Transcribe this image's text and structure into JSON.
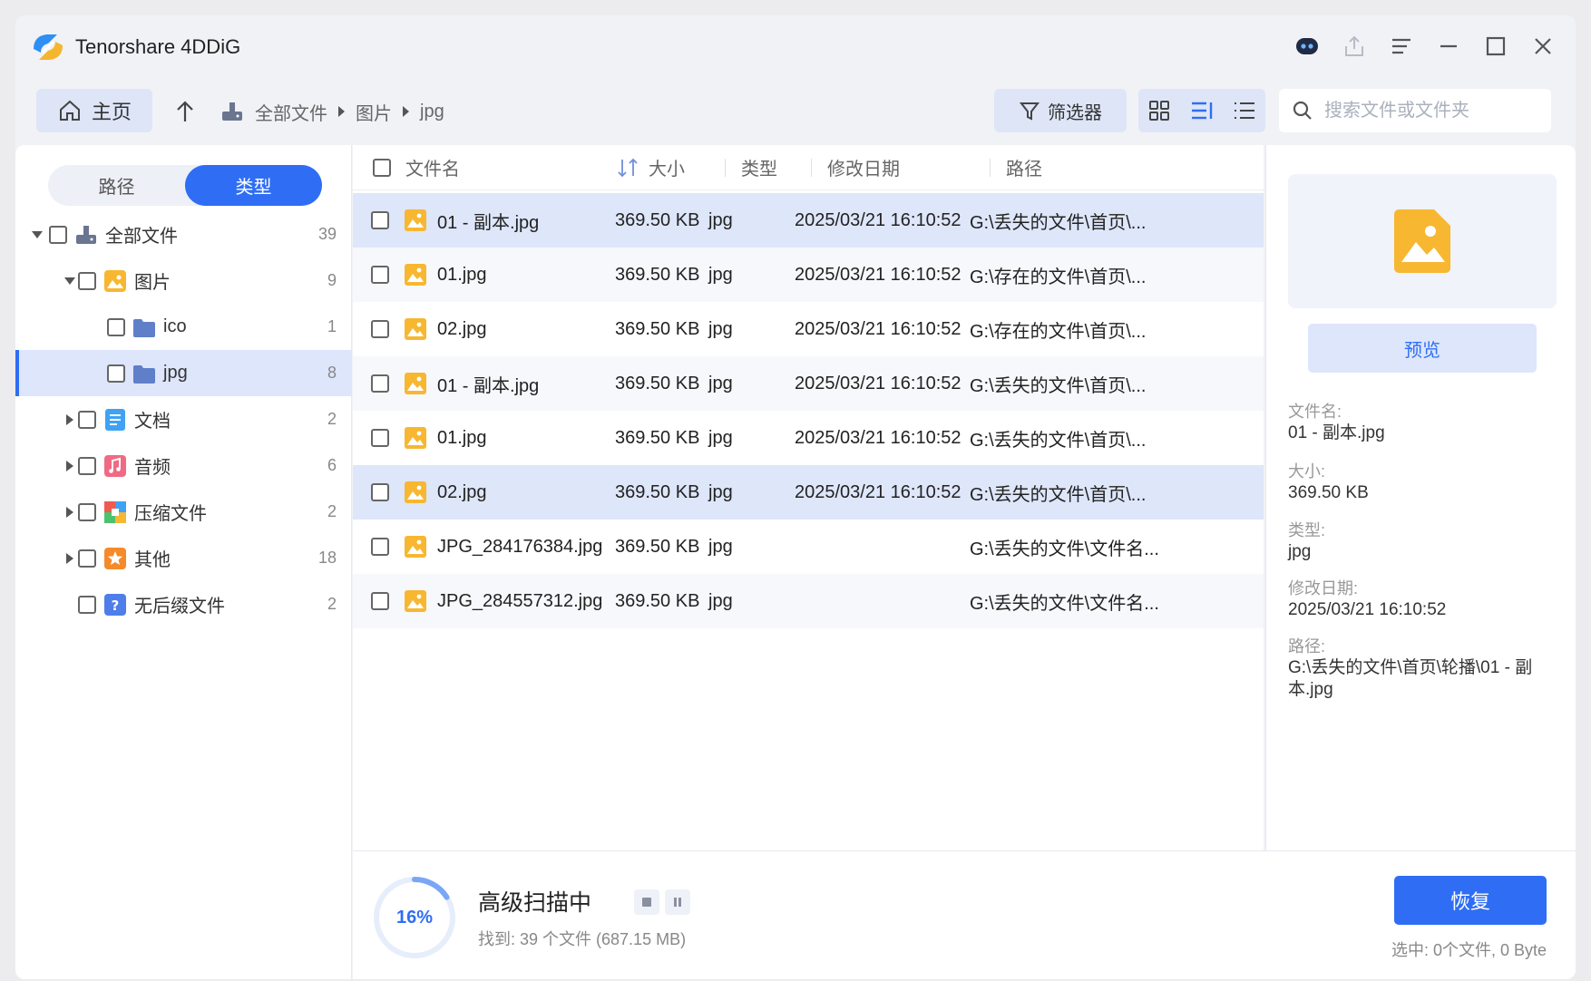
{
  "app": {
    "title": "Tenorshare 4DDiG"
  },
  "toolbar": {
    "home_label": "主页",
    "breadcrumb": [
      "全部文件",
      "图片",
      "jpg"
    ],
    "filter_label": "筛选器",
    "search_placeholder": "搜索文件或文件夹"
  },
  "sidebar": {
    "tabs": [
      {
        "label": "路径",
        "active": false
      },
      {
        "label": "类型",
        "active": true
      }
    ],
    "tree": [
      {
        "label": "全部文件",
        "count": "39",
        "level": 0,
        "expanded": true,
        "icon": "drive-icon"
      },
      {
        "label": "图片",
        "count": "9",
        "level": 1,
        "expanded": true,
        "icon": "image-folder-icon"
      },
      {
        "label": "ico",
        "count": "1",
        "level": 2,
        "icon": "folder-icon"
      },
      {
        "label": "jpg",
        "count": "8",
        "level": 2,
        "icon": "folder-icon",
        "selected": true
      },
      {
        "label": "文档",
        "count": "2",
        "level": 1,
        "expanded": false,
        "icon": "document-icon"
      },
      {
        "label": "音频",
        "count": "6",
        "level": 1,
        "expanded": false,
        "icon": "audio-icon"
      },
      {
        "label": "压缩文件",
        "count": "2",
        "level": 1,
        "expanded": false,
        "icon": "archive-icon"
      },
      {
        "label": "其他",
        "count": "18",
        "level": 1,
        "expanded": false,
        "icon": "other-icon"
      },
      {
        "label": "无后缀文件",
        "count": "2",
        "level": 1,
        "icon": "unknown-file-icon"
      }
    ]
  },
  "table": {
    "headers": {
      "name": "文件名",
      "size": "大小",
      "type": "类型",
      "date": "修改日期",
      "path": "路径"
    },
    "rows": [
      {
        "name": "01 - 副本.jpg",
        "size": "369.50 KB",
        "type": "jpg",
        "date": "2025/03/21 16:10:52",
        "path": "G:\\丢失的文件\\首页\\..."
      },
      {
        "name": "01.jpg",
        "size": "369.50 KB",
        "type": "jpg",
        "date": "2025/03/21 16:10:52",
        "path": "G:\\存在的文件\\首页\\..."
      },
      {
        "name": "02.jpg",
        "size": "369.50 KB",
        "type": "jpg",
        "date": "2025/03/21 16:10:52",
        "path": "G:\\存在的文件\\首页\\..."
      },
      {
        "name": "01 - 副本.jpg",
        "size": "369.50 KB",
        "type": "jpg",
        "date": "2025/03/21 16:10:52",
        "path": "G:\\丢失的文件\\首页\\..."
      },
      {
        "name": "01.jpg",
        "size": "369.50 KB",
        "type": "jpg",
        "date": "2025/03/21 16:10:52",
        "path": "G:\\丢失的文件\\首页\\..."
      },
      {
        "name": "02.jpg",
        "size": "369.50 KB",
        "type": "jpg",
        "date": "2025/03/21 16:10:52",
        "path": "G:\\丢失的文件\\首页\\..."
      },
      {
        "name": "JPG_284176384.jpg",
        "size": "369.50 KB",
        "type": "jpg",
        "date": "",
        "path": "G:\\丢失的文件\\文件名..."
      },
      {
        "name": "JPG_284557312.jpg",
        "size": "369.50 KB",
        "type": "jpg",
        "date": "",
        "path": "G:\\丢失的文件\\文件名..."
      }
    ]
  },
  "preview": {
    "button_label": "预览",
    "name_label": "文件名:",
    "name_value": "01 - 副本.jpg",
    "size_label": "大小:",
    "size_value": "369.50 KB",
    "type_label": "类型:",
    "type_value": "jpg",
    "date_label": "修改日期:",
    "date_value": "2025/03/21 16:10:52",
    "path_label": "路径:",
    "path_value": "G:\\丢失的文件\\首页\\轮播\\01 - 副本.jpg"
  },
  "status": {
    "progress_percent": "16%",
    "progress_value": 0.16,
    "title": "高级扫描中",
    "found_text": "找到: 39 个文件 (687.15 MB)",
    "recover_label": "恢复",
    "selected_text": "选中: 0个文件, 0 Byte"
  },
  "colors": {
    "accent": "#2f6ef4",
    "selected_row": "#dee6fa",
    "image_icon": "#f7b731"
  }
}
